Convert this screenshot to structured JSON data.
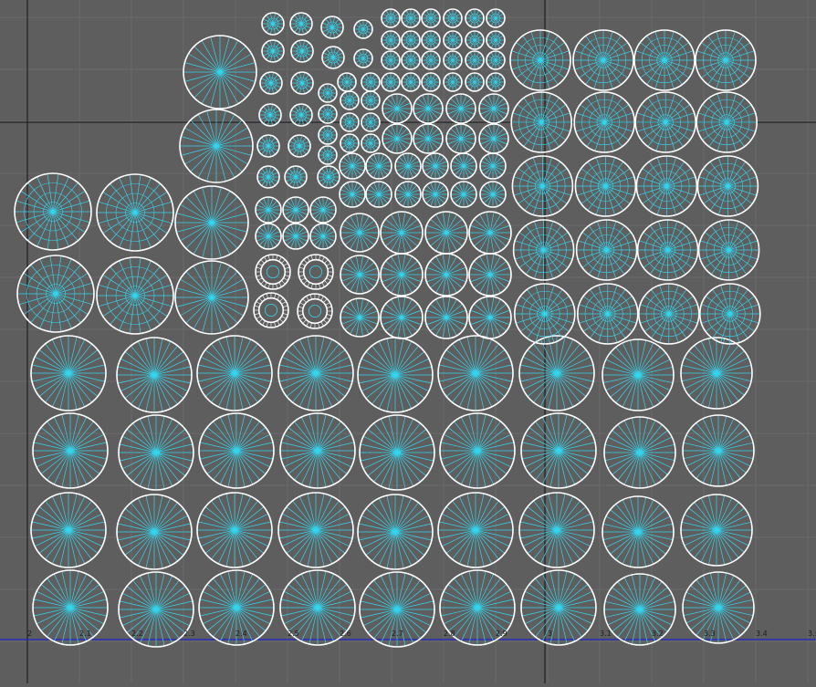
{
  "viewport": {
    "background": "#5e5e5e",
    "grid_color": "#6a6a6a",
    "axis_color": "#111111",
    "u_axis_color": "#2222cc",
    "wire_color": "#ffffff",
    "spoke_color": "#33d6f0"
  },
  "ruler": {
    "labels": [
      "2",
      "2.1",
      "2.2",
      "2.3",
      "2.4",
      "2.5",
      "2.6",
      "2.7",
      "2.8",
      "2.9",
      "3",
      "3.1",
      "3.2",
      "3.3",
      "3.4",
      "3.5"
    ]
  },
  "uv_islands": {
    "top_left_stack_count": 3,
    "left_pair_count": 4,
    "mid_column_count": 5,
    "large_block_rows": 4,
    "large_block_cols": 9,
    "right_block_rows": 5,
    "right_block_cols": 4,
    "small_center_block": "dense grid of small island discs"
  }
}
